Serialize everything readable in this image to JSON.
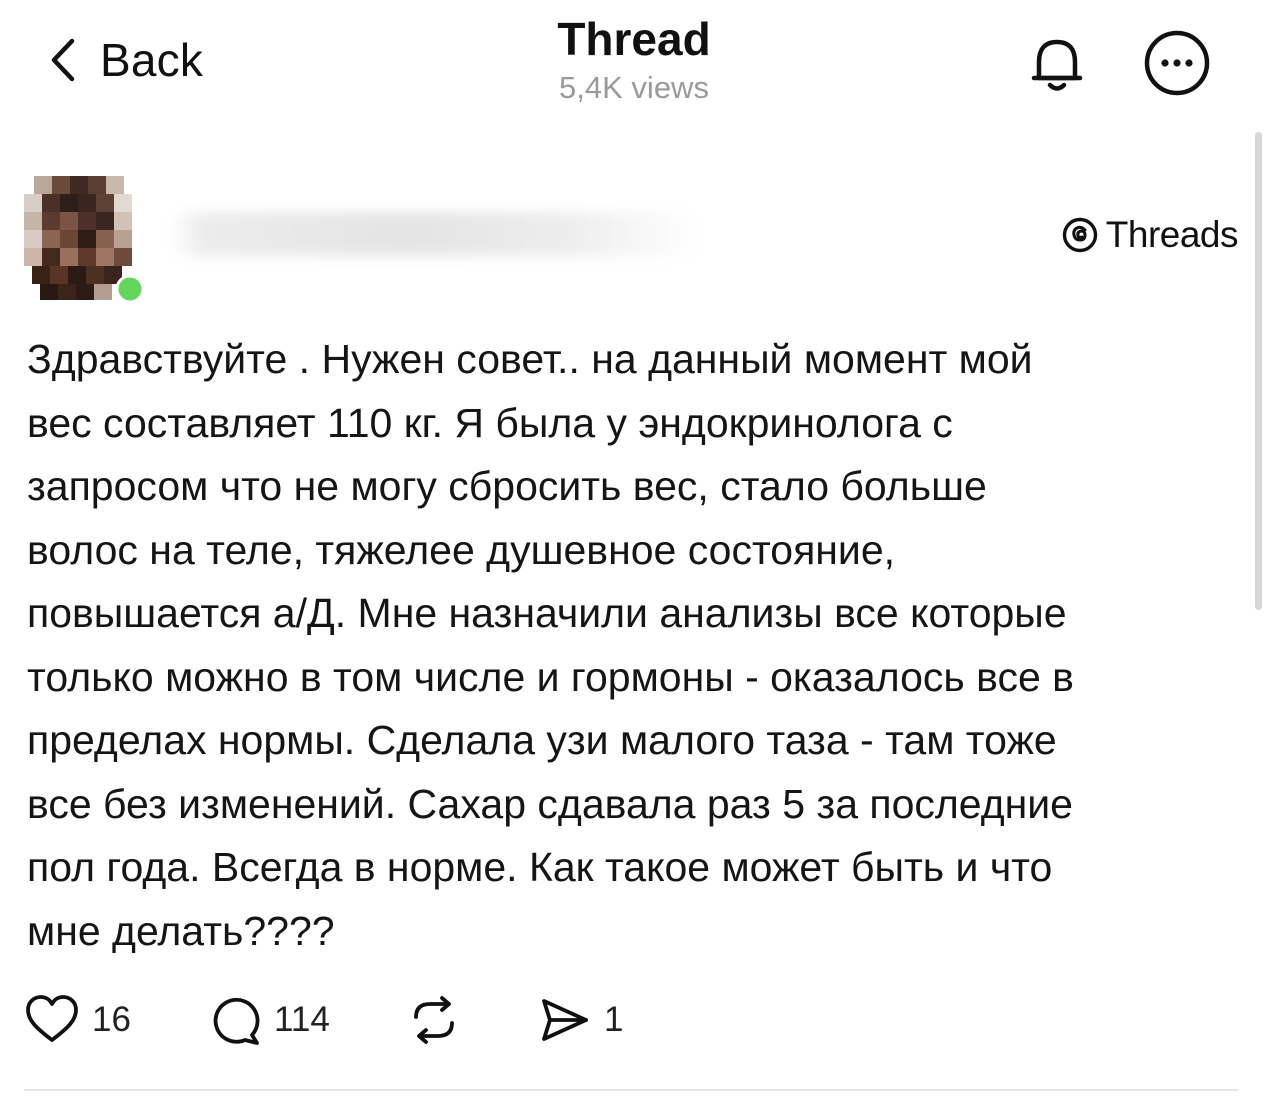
{
  "header": {
    "back_label": "Back",
    "title": "Thread",
    "views": "5,4K views"
  },
  "post": {
    "badge_label": "Threads",
    "lines": [
      "Здравствуйте . Нужен совет.. на данный момент мой",
      "вес составляет 110 кг. Я была у эндокринолога с",
      "запросом что не могу сбросить вес, стало больше",
      "волос на теле, тяжелее душевное состояние,",
      "повышается а/Д. Мне назначили анализы все которые",
      "только можно в том числе и гормоны - оказалось все в",
      "пределах нормы. Сделала узи малого таза - там тоже",
      "все без изменений. Сахар сдавала раз 5 за последние",
      "пол года. Всегда в норме. Как такое может быть и что",
      "мне делать????"
    ]
  },
  "actions": {
    "likes": "16",
    "replies": "114",
    "shares": "1"
  },
  "icons": {
    "back": "chevron-left-icon",
    "bell": "bell-icon",
    "more": "more-icon",
    "threads": "threads-logo-icon",
    "like": "heart-icon",
    "reply": "comment-icon",
    "repost": "repost-icon",
    "share": "send-icon"
  },
  "colors": {
    "text": "#151515",
    "secondary": "#9a9a9a",
    "online": "#62d75b",
    "divider": "#e6e6e6"
  }
}
